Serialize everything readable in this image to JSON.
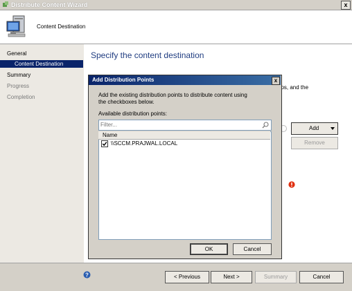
{
  "window": {
    "title": "Distribute Content Wizard",
    "close_label": "x",
    "header_title": "Content Destination"
  },
  "sidebar": {
    "items": [
      {
        "label": "General",
        "state": "normal"
      },
      {
        "label": "Content Destination",
        "state": "selected"
      },
      {
        "label": "Summary",
        "state": "normal"
      },
      {
        "label": "Progress",
        "state": "disabled"
      },
      {
        "label": "Completion",
        "state": "disabled"
      }
    ]
  },
  "main": {
    "title": "Specify the content destination",
    "partial_text": "ups, and the",
    "add_label": "Add",
    "remove_label": "Remove"
  },
  "footer": {
    "previous_label": "< Previous",
    "next_label": "Next >",
    "summary_label": "Summary",
    "cancel_label": "Cancel"
  },
  "dialog": {
    "title": "Add Distribution Points",
    "close_label": "x",
    "description": "Add the existing distribution points to distribute content using the checkboxes below.",
    "available_label": "Available distribution points:",
    "filter_placeholder": "Filter...",
    "column_name": "Name",
    "rows": [
      {
        "name": "\\\\SCCM.PRAJWAL.LOCAL",
        "checked": true
      }
    ],
    "ok_label": "OK",
    "cancel_label": "Cancel"
  },
  "colors": {
    "accent": "#0a246a",
    "title_text": "#1f3c80",
    "warning": "#e03010",
    "help": "#2a5db0"
  }
}
